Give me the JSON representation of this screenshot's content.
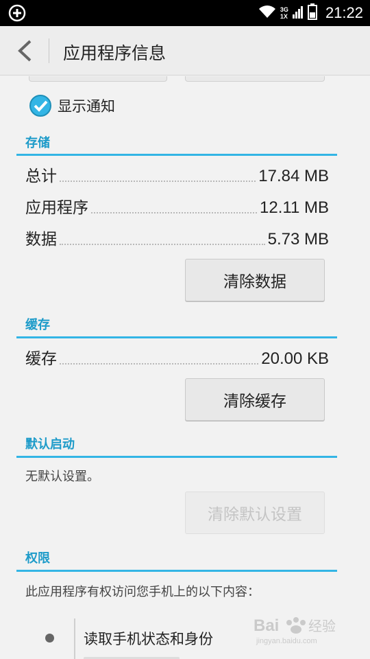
{
  "status_bar": {
    "network_top": "3G",
    "network_bottom": "1X",
    "time": "21:22"
  },
  "action_bar": {
    "title": "应用程序信息"
  },
  "notification": {
    "label": "显示通知",
    "checked": true
  },
  "storage": {
    "section_title": "存储",
    "rows": [
      {
        "label": "总计",
        "value": "17.84 MB"
      },
      {
        "label": "应用程序",
        "value": "12.11 MB"
      },
      {
        "label": "数据",
        "value": "5.73 MB"
      }
    ],
    "clear_button": "清除数据"
  },
  "cache": {
    "section_title": "缓存",
    "row": {
      "label": "缓存",
      "value": "20.00 KB"
    },
    "clear_button": "清除缓存"
  },
  "default_launch": {
    "section_title": "默认启动",
    "status": "无默认设置。",
    "clear_button": "清除默认设置"
  },
  "permissions": {
    "section_title": "权限",
    "description": "此应用程序有权访问您手机上的以下内容：",
    "items": [
      "读取手机状态和身份"
    ]
  },
  "colors": {
    "accent": "#33b5e5",
    "section_text": "#1d9bc9",
    "checkbox": "#33b5e5"
  },
  "watermark": {
    "brand": "Bai",
    "brand_suffix": "经验",
    "url": "jingyan.baidu.com"
  }
}
